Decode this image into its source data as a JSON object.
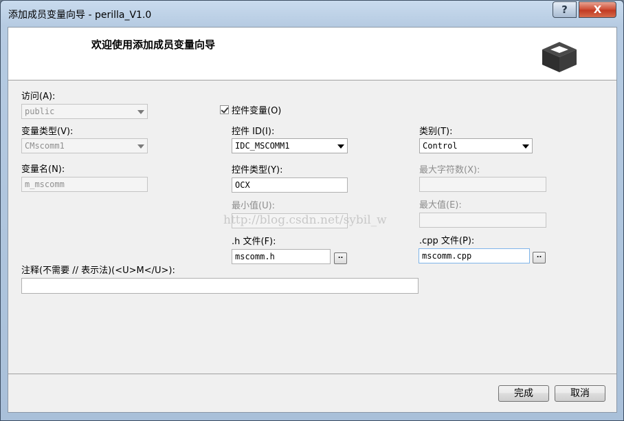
{
  "window": {
    "title": "添加成员变量向导 - perilla_V1.0",
    "help_label": "?",
    "close_label": "X"
  },
  "header": {
    "title": "欢迎使用添加成员变量向导",
    "icon": "box-icon"
  },
  "form": {
    "access": {
      "label": "访问(A):",
      "value": "public",
      "disabled": true
    },
    "control_var": {
      "label": "控件变量(O)",
      "checked": true
    },
    "var_type": {
      "label": "变量类型(V):",
      "value": "CMscomm1",
      "disabled": true
    },
    "control_id": {
      "label": "控件 ID(I):",
      "value": "IDC_MSCOMM1"
    },
    "category": {
      "label": "类别(T):",
      "value": "Control"
    },
    "var_name": {
      "label": "变量名(N):",
      "value": "m_mscomm",
      "disabled": true
    },
    "control_type": {
      "label": "控件类型(Y):",
      "value": "OCX"
    },
    "max_chars": {
      "label": "最大字符数(X):",
      "value": "",
      "disabled": true
    },
    "min_value": {
      "label": "最小值(U):",
      "value": "",
      "disabled": true
    },
    "max_value": {
      "label": "最大值(E):",
      "value": "",
      "disabled": true
    },
    "h_file": {
      "label": ".h 文件(F):",
      "value": "mscomm.h",
      "browse": ".."
    },
    "cpp_file": {
      "label": ".cpp 文件(P):",
      "value": "mscomm.cpp",
      "browse": ".."
    },
    "comment": {
      "label": "注释(不需要 // 表示法)(<U>M</U>):",
      "value": ""
    }
  },
  "footer": {
    "finish_label": "完成",
    "cancel_label": "取消"
  },
  "watermark": "http://blog.csdn.net/sybil_w"
}
